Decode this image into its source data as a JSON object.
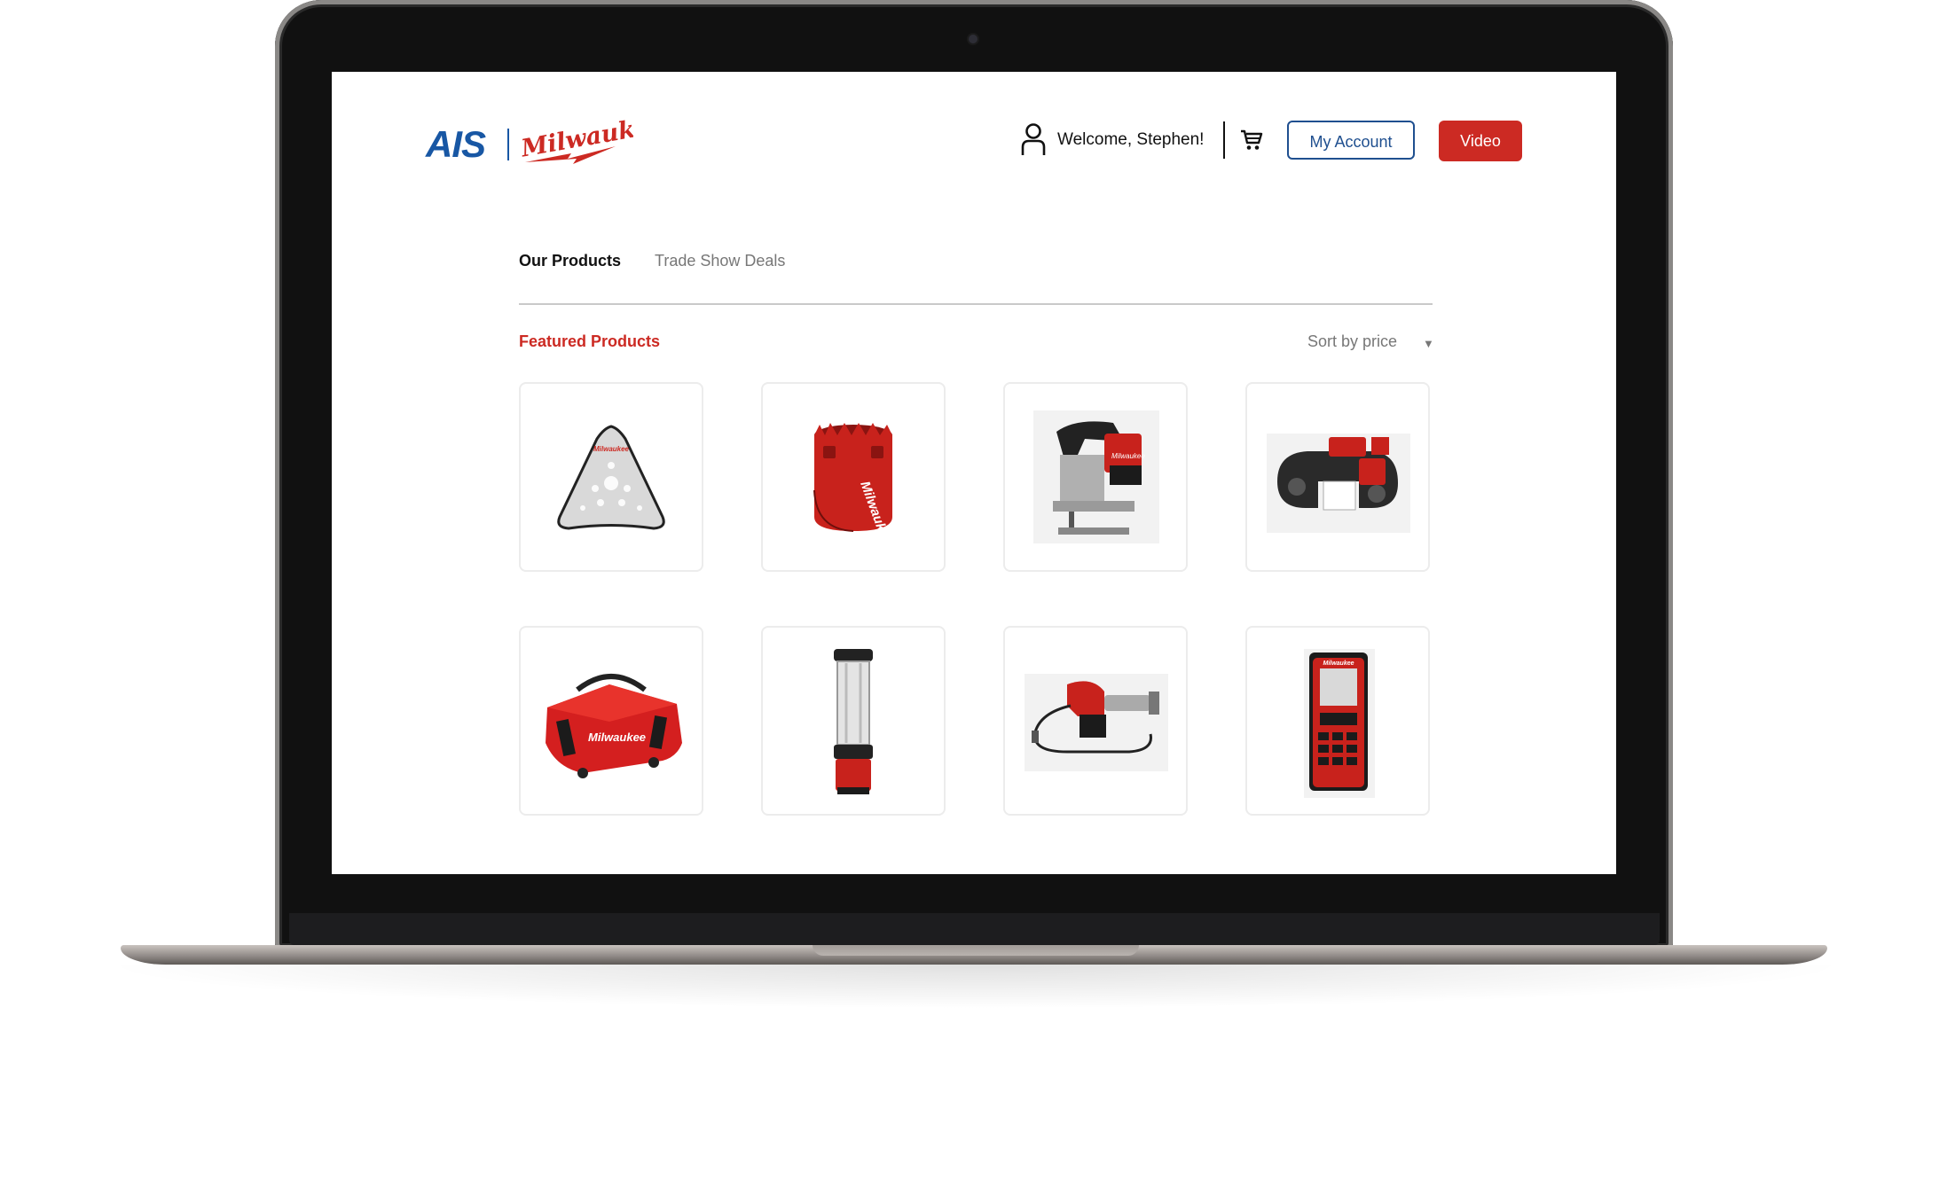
{
  "brand": {
    "primary_logo": "AIS",
    "partner_logo": "Milwaukee",
    "colors": {
      "blue": "#1857a4",
      "red": "#cc2a23"
    }
  },
  "header": {
    "welcome_text": "Welcome, Stephen!",
    "my_account_label": "My Account",
    "video_label": "Video",
    "user_icon": "user-icon",
    "cart_icon": "cart-icon"
  },
  "tabs": [
    {
      "label": "Our Products",
      "active": true
    },
    {
      "label": "Trade Show Deals",
      "active": false
    }
  ],
  "section": {
    "title": "Featured Products",
    "sort_label": "Sort by price"
  },
  "products": [
    {
      "image": "sanding-pad"
    },
    {
      "image": "hole-saw"
    },
    {
      "image": "jigsaw"
    },
    {
      "image": "band-saw"
    },
    {
      "image": "tool-bag"
    },
    {
      "image": "lantern"
    },
    {
      "image": "grease-gun"
    },
    {
      "image": "laser-distance-meter"
    }
  ]
}
